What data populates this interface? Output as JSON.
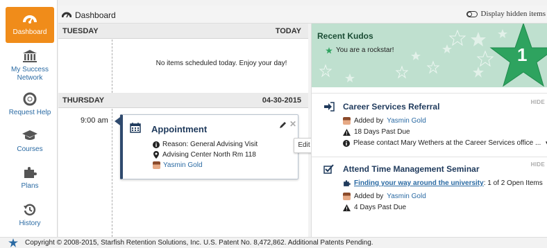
{
  "sidebar": {
    "items": [
      {
        "label": "Dashboard",
        "icon": "dashboard-gauge-icon",
        "active": true
      },
      {
        "label": "My Success Network",
        "icon": "building-columns-icon"
      },
      {
        "label": "Request Help",
        "icon": "lifebuoy-icon"
      },
      {
        "label": "Courses",
        "icon": "graduation-cap-icon"
      },
      {
        "label": "Plans",
        "icon": "puzzle-piece-icon"
      },
      {
        "label": "History",
        "icon": "history-clock-icon"
      }
    ]
  },
  "topbar": {
    "title": "Dashboard",
    "display_hidden_label": "Display hidden items"
  },
  "calendar": {
    "today": {
      "day": "TUESDAY",
      "label": "TODAY",
      "empty_message": "No items scheduled today. Enjoy your day!"
    },
    "next": {
      "day": "THURSDAY",
      "date": "04-30-2015"
    },
    "appointment": {
      "time": "9:00 am",
      "title": "Appointment",
      "reason": "Reason: General Advising Visit",
      "location": "Advising Center North Rm 118",
      "person": "Yasmin Gold",
      "edit_tooltip": "Edit"
    }
  },
  "kudos": {
    "title": "Recent Kudos",
    "message": "You are a rockstar!",
    "count": "1"
  },
  "cards": [
    {
      "title": "Career Services Referral",
      "hide_label": "HIDE",
      "added_by_prefix": "Added by",
      "added_by": "Yasmin Gold",
      "status": "18 Days Past Due",
      "note": "Please contact Mary Wethers at the Career Services office ..."
    },
    {
      "title": "Attend Time Management Seminar",
      "hide_label": "HIDE",
      "link_text": "Finding your way around the university",
      "link_suffix": ": 1 of 2 Open Items",
      "added_by_prefix": "Added by",
      "added_by": "Yasmin Gold",
      "status": "4 Days Past Due"
    }
  ],
  "footer": {
    "copyright": "Copyright © 2008-2015, Starfish Retention Solutions, Inc. U.S. Patent No. 8,472,862. Additional Patents Pending."
  },
  "colors": {
    "accent_orange": "#f08c1a",
    "link_blue": "#2a6aa3",
    "kudos_green": "#2ea35f",
    "title_navy": "#1f3a5c"
  }
}
